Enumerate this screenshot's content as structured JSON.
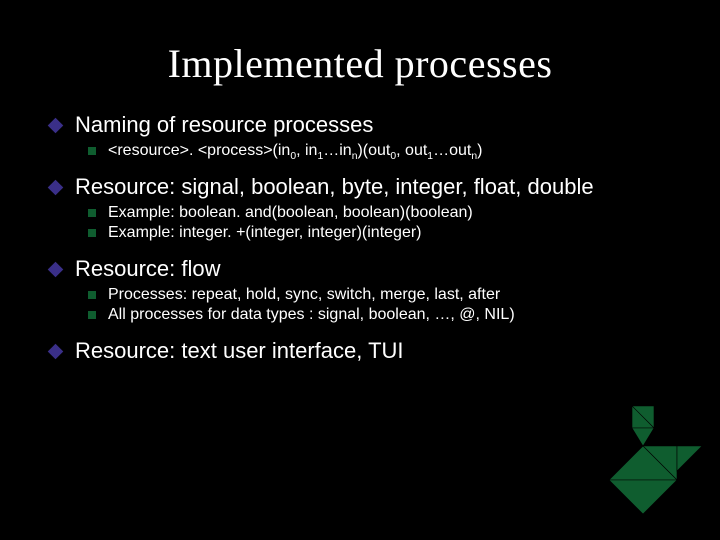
{
  "colors": {
    "background": "#000000",
    "text": "#ffffff",
    "diamond_bullet": "#3a2f88",
    "square_bullet": "#0f5d2f",
    "tangram": "#0f5d2f"
  },
  "title": "Implemented processes",
  "items": [
    {
      "text": "Naming of resource processes",
      "children": [
        {
          "html": "&lt;resource&gt;. &lt;process&gt;(in<span class='subscript'>0</span>, in<span class='subscript'>1</span>…in<span class='subscript'>n</span>)(out<span class='subscript'>0</span>, out<span class='subscript'>1</span>…out<span class='subscript'>n</span>)"
        }
      ]
    },
    {
      "text": "Resource: signal, boolean, byte, integer, float, double",
      "children": [
        {
          "text": "Example: boolean. and(boolean, boolean)(boolean)"
        },
        {
          "text": "Example: integer. +(integer, integer)(integer)"
        }
      ]
    },
    {
      "text": "Resource: flow",
      "children": [
        {
          "text": "Processes: repeat, hold, sync, switch, merge, last, after"
        },
        {
          "text": "All processes for data types : signal, boolean, …, @, NIL)"
        }
      ]
    },
    {
      "text": "Resource: text user interface, TUI",
      "children": []
    }
  ]
}
